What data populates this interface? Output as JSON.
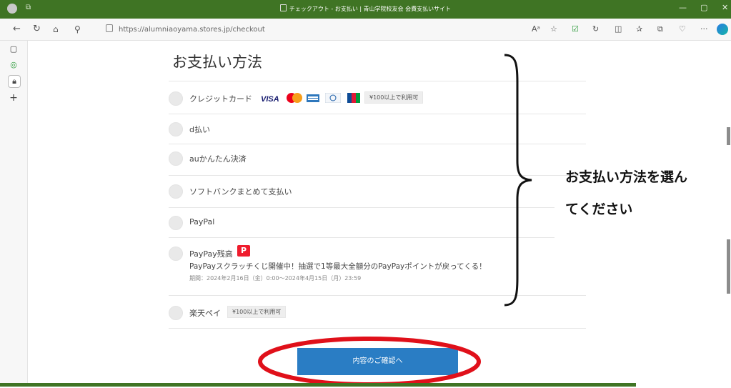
{
  "browser": {
    "window_title": "チェックアウト - お支払い | 青山学院校友会 会費支払いサイト",
    "url": "https://alumniaoyama.stores.jp/checkout"
  },
  "payment": {
    "heading": "お支払い方法",
    "options": [
      {
        "label": "クレジットカード",
        "badge": "¥100以上で利用可"
      },
      {
        "label": "d払い"
      },
      {
        "label": "auかんたん決済"
      },
      {
        "label": "ソフトバンクまとめて支払い"
      },
      {
        "label": "PayPal"
      },
      {
        "label": "PayPay残高",
        "promo": "PayPayスクラッチくじ開催中！抽選で1等最大全額分のPayPayポイントが戻ってくる！",
        "period": "期間：2024年2月16日（金）0:00〜2024年4月15日（月）23:59"
      },
      {
        "label": "楽天ペイ",
        "badge": "¥100以上で利用可"
      }
    ],
    "card_brands": [
      "VISA",
      "Mastercard",
      "AMEX",
      "Diners Club",
      "JCB"
    ],
    "confirm_button": "内容のご確認へ"
  },
  "annotation": {
    "line1": "お支払い方法を選ん",
    "line2": "てください"
  },
  "colors": {
    "titlebar": "#3f7424",
    "button": "#2a7dc4",
    "annotation_circle": "#e0101a"
  },
  "icons": [
    "profile-icon",
    "tabs-icon",
    "back-icon",
    "refresh-icon",
    "home-icon",
    "search-icon",
    "lock-icon",
    "read-aloud-icon",
    "favorite-icon",
    "extension-icon",
    "split-screen-icon",
    "favorites-bar-icon",
    "collections-icon",
    "browser-essentials-icon",
    "more-icon",
    "copilot-icon",
    "paypay-icon"
  ]
}
